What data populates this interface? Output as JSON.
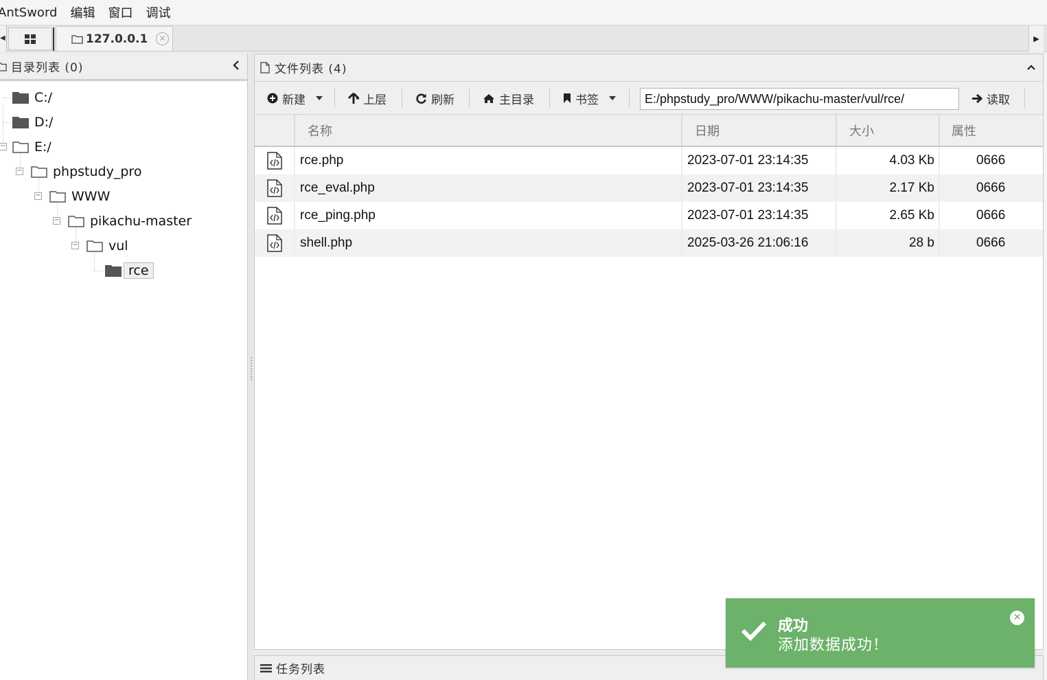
{
  "menubar": {
    "items": [
      "AntSword",
      "编辑",
      "窗口",
      "调试"
    ]
  },
  "tabs": {
    "host_label": "127.0.0.1",
    "close_glyph": "⊗"
  },
  "dir_panel": {
    "title": "目录列表 (0)",
    "tree": [
      {
        "label": "C:/"
      },
      {
        "label": "D:/"
      },
      {
        "label": "E:/"
      },
      {
        "label": "phpstudy_pro"
      },
      {
        "label": "WWW"
      },
      {
        "label": "pikachu-master"
      },
      {
        "label": "vul"
      },
      {
        "label": "rce"
      }
    ]
  },
  "file_panel": {
    "title": "文件列表 (4)",
    "toolbar": {
      "new_label": "新建",
      "up_label": "上层",
      "refresh_label": "刷新",
      "home_label": "主目录",
      "bookmark_label": "书签",
      "path_value": "E:/phpstudy_pro/WWW/pikachu-master/vul/rce/",
      "read_label": "读取"
    },
    "columns": {
      "name": "名称",
      "date": "日期",
      "size": "大小",
      "attr": "属性"
    },
    "rows": [
      {
        "name": "rce.php",
        "date": "2023-07-01 23:14:35",
        "size": "4.03 Kb",
        "attr": "0666"
      },
      {
        "name": "rce_eval.php",
        "date": "2023-07-01 23:14:35",
        "size": "2.17 Kb",
        "attr": "0666"
      },
      {
        "name": "rce_ping.php",
        "date": "2023-07-01 23:14:35",
        "size": "2.65 Kb",
        "attr": "0666"
      },
      {
        "name": "shell.php",
        "date": "2025-03-26 21:06:16",
        "size": "28 b",
        "attr": "0666"
      }
    ]
  },
  "task_panel": {
    "title": "任务列表"
  },
  "toast": {
    "title": "成功",
    "message": "添加数据成功！",
    "color": "#6cb26a"
  }
}
